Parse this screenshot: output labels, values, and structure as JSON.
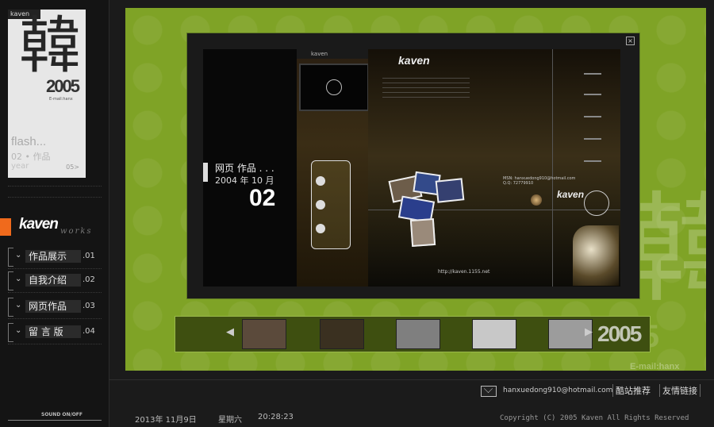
{
  "sidebar": {
    "thumb": {
      "tag": "kaven",
      "big_char": "韓",
      "year": "2005",
      "email_small": "E-mail:hanx",
      "flash": "flash...",
      "subtitle": "02 • 作品",
      "year_label": "year",
      "counter": "05>"
    },
    "logo": "kaven",
    "logo_sub": "works",
    "nav": [
      {
        "label": "作品展示",
        "num": ".01"
      },
      {
        "label": "自我介绍",
        "num": ".02"
      },
      {
        "label": "网页作品",
        "num": ".03"
      },
      {
        "label": "留 言 版",
        "num": ".04"
      }
    ],
    "sound": "SOUND ON/OFF"
  },
  "stage": {
    "bg_char": "韓",
    "bg_year": "2005",
    "bg_email": "E-mail:hanx"
  },
  "preview": {
    "close": "×",
    "title_line1": "网页 作品 . . .",
    "title_line2": "2004 年 10 月",
    "title_number": "02",
    "topbar_logo": "kaven",
    "site_logo": "kaven",
    "site_logo2": "kaven",
    "contact1": "MSN: hanxuedong910@hotmail.com",
    "contact2": "Q.Q: 72779910",
    "url": "http://kaven.1155.net"
  },
  "filmstrip": {
    "left_arrow": "◀",
    "right_arrow": "▶",
    "year": "2005",
    "thumbs": [
      "#5b4a3b",
      "#3a3020",
      "#7f7f7f",
      "#c8c8c8",
      "#9c9c9c"
    ]
  },
  "footer": {
    "email": "hanxuedong910@hotmail.com",
    "recommend": "酷站推荐",
    "links": "友情链接",
    "date": "2013年 11月9日",
    "weekday": "星期六",
    "time": "20:28:23",
    "copyright": "Copyright (C) 2005 Kaven All Rights Reserved"
  }
}
